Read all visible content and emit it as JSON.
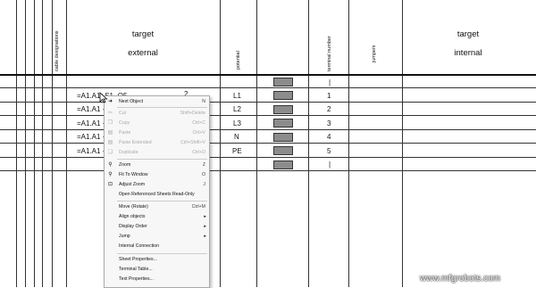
{
  "headers": {
    "cable": "cable designations",
    "target": "target",
    "external": "external",
    "potential": "potential",
    "terminal": "terminal number",
    "jumpers": "jumpers",
    "target2": "target",
    "internal": "internal"
  },
  "rows": [
    {
      "designation": "=A1.A1+S1 -Q5",
      "potential": "L1",
      "terminal": "1"
    },
    {
      "designation": "=A1.A1 +S",
      "potential": "L2",
      "terminal": "2"
    },
    {
      "designation": "=A1.A1 +S",
      "potential": "L3",
      "terminal": "3"
    },
    {
      "designation": "=A1.A1 +S",
      "potential": "N",
      "terminal": "4"
    },
    {
      "designation": "=A1.A1 +S",
      "potential": "PE",
      "terminal": "5"
    }
  ],
  "extra_terminals": {
    "top": "|",
    "bottom": "|"
  },
  "cell_note": "2",
  "menu": {
    "items": [
      {
        "label": "Next Object",
        "shortcut": "N"
      },
      {
        "label": "Cut",
        "shortcut": "Shift+Delete"
      },
      {
        "label": "Copy",
        "shortcut": "Ctrl+C"
      },
      {
        "label": "Paste",
        "shortcut": "Ctrl+V"
      },
      {
        "label": "Paste Extended",
        "shortcut": "Ctrl+Shift+V"
      },
      {
        "label": "Duplicate",
        "shortcut": "Ctrl+D"
      },
      {
        "label": "Zoom",
        "shortcut": "Z"
      },
      {
        "label": "Fit To Window",
        "shortcut": "O"
      },
      {
        "label": "Adjust Zoom",
        "shortcut": "J"
      },
      {
        "label": "Open Referenced Sheets Read-Only",
        "shortcut": ""
      },
      {
        "label": "Move (Rotate)",
        "shortcut": "Ctrl+M"
      },
      {
        "label": "Align objects",
        "shortcut": ""
      },
      {
        "label": "Display Order",
        "shortcut": ""
      },
      {
        "label": "Jump",
        "shortcut": ""
      },
      {
        "label": "Internal Connection",
        "shortcut": ""
      },
      {
        "label": "Sheet Properties...",
        "shortcut": ""
      },
      {
        "label": "Terminal Table...",
        "shortcut": ""
      },
      {
        "label": "Text Properties...",
        "shortcut": ""
      }
    ]
  },
  "watermark": "www.mfgrobots.com"
}
